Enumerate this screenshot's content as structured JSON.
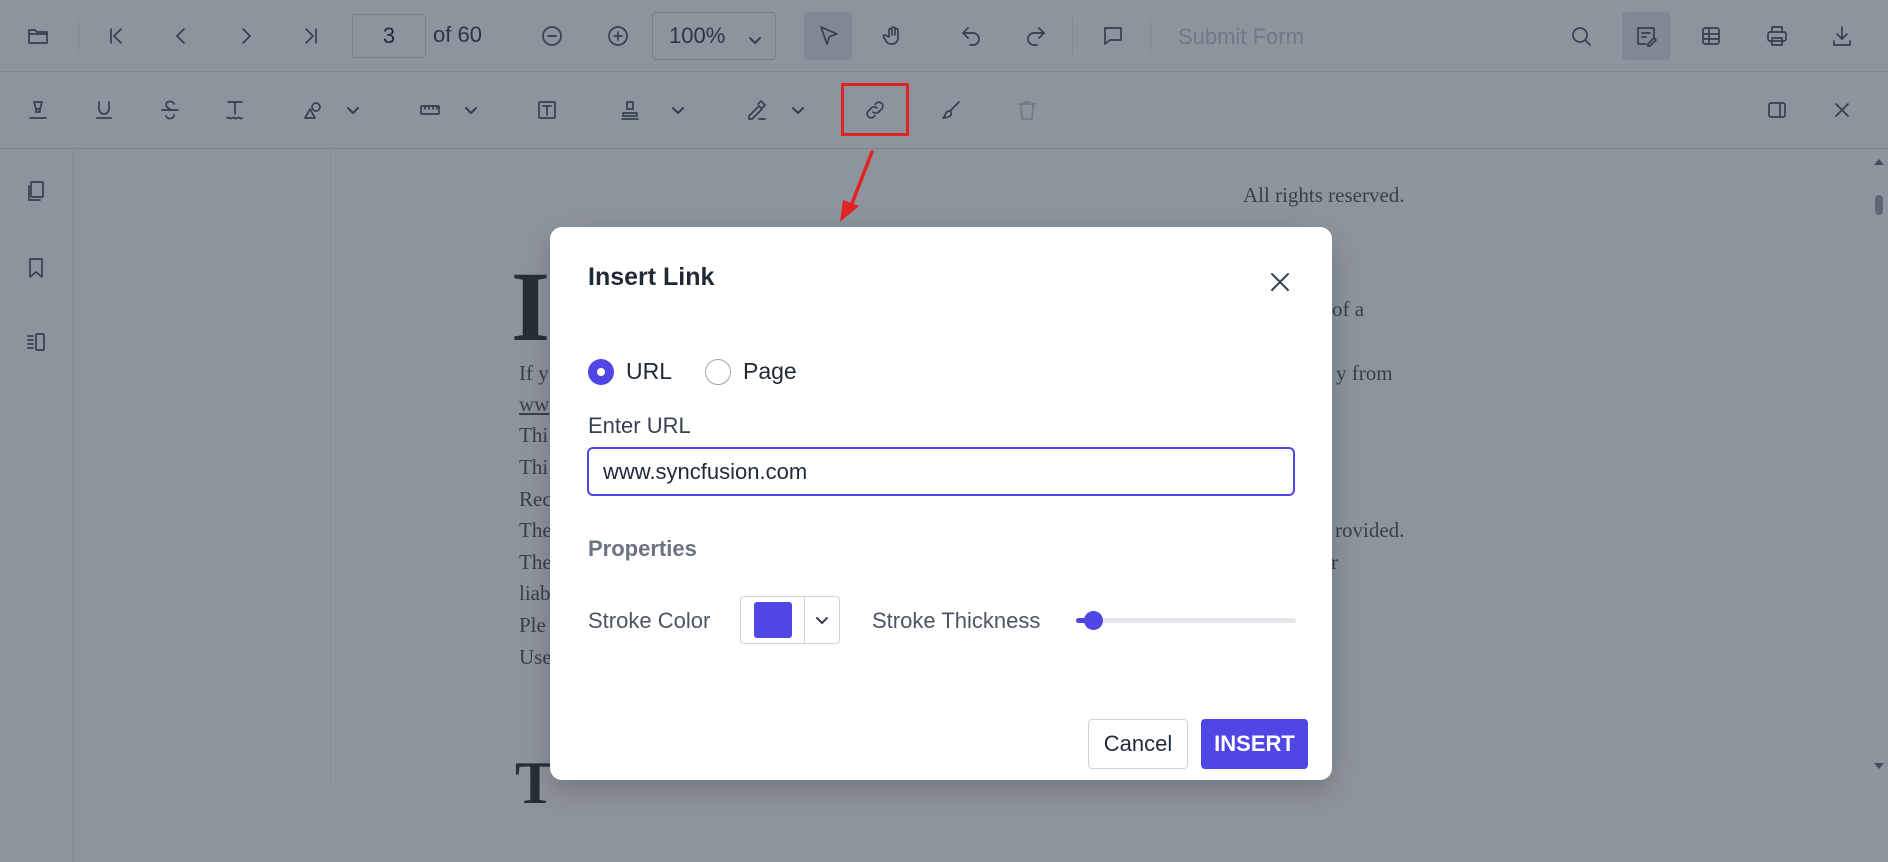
{
  "toolbar": {
    "current_page": "3",
    "page_count_label": "of 60",
    "zoom_value": "100%",
    "submit_form_label": "Submit Form"
  },
  "document": {
    "lines_right": [
      "All rights reserved.",
      "of a",
      "y from",
      "rovided.",
      "r"
    ],
    "lines_left": [
      "If y",
      "ww",
      "Thi",
      "Thi",
      "Rec",
      "The",
      "The",
      "liab",
      "Ple",
      "Use"
    ],
    "big_letters": [
      "I",
      "T"
    ]
  },
  "dialog": {
    "title": "Insert Link",
    "radio_url_label": "URL",
    "radio_page_label": "Page",
    "selected_option": "URL",
    "enter_url_label": "Enter URL",
    "url_value": "www.syncfusion.com",
    "properties_label": "Properties",
    "stroke_color_label": "Stroke Color",
    "stroke_color": "#4f46e5",
    "stroke_thickness_label": "Stroke Thickness",
    "stroke_thickness_fraction": 0.08,
    "cancel_label": "Cancel",
    "insert_label": "INSERT"
  },
  "colors": {
    "accent": "#4f46e5",
    "highlight": "#e02424"
  }
}
